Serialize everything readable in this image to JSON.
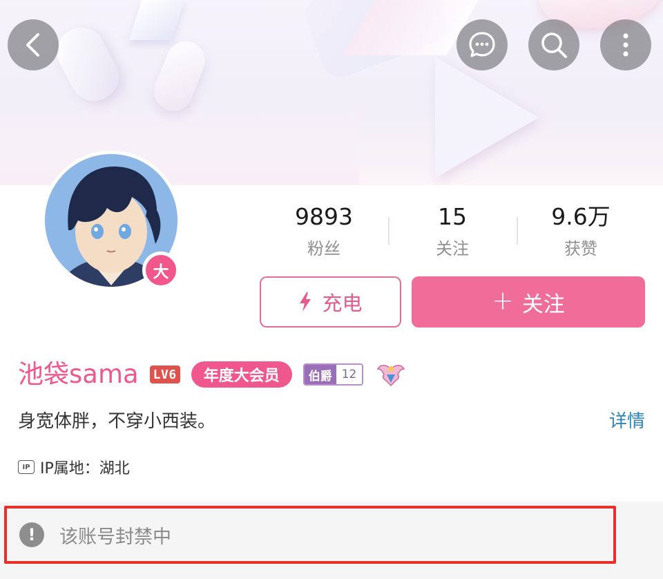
{
  "header": {
    "icons": [
      "back-arrow-icon",
      "chat-bubble-icon",
      "search-icon",
      "more-vertical-icon"
    ]
  },
  "profile": {
    "avatar_badge": "大",
    "stats": [
      {
        "value": "9893",
        "label": "粉丝"
      },
      {
        "value": "15",
        "label": "关注"
      },
      {
        "value": "9.6万",
        "label": "获赞"
      }
    ],
    "charge_button": {
      "label": "充电",
      "icon": "lightning-icon"
    },
    "follow_button": {
      "plus": "+",
      "label": "关注"
    },
    "username": "池袋sama",
    "level_badge": "LV6",
    "vip_tag": "年度大会员",
    "medal": {
      "name": "伯爵",
      "level": "12"
    },
    "bio": "身宽体胖，不穿小西装。",
    "details_link": "详情",
    "ip": {
      "icon": "IP",
      "text": "IP属地：湖北"
    }
  },
  "notice": {
    "icon": "!",
    "text": "该账号封禁中"
  },
  "colors": {
    "accent_pink": "#f06d9a",
    "username_pink": "#f0578c",
    "link_blue": "#2d84b8",
    "ban_border_red": "#e8302a"
  }
}
